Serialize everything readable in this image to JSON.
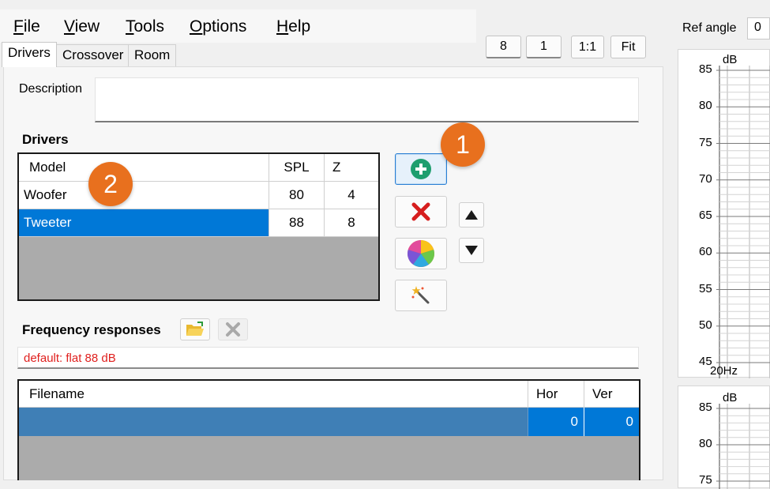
{
  "menu": {
    "items": [
      {
        "pre": "",
        "key": "F",
        "post": "ile"
      },
      {
        "pre": "",
        "key": "V",
        "post": "iew"
      },
      {
        "pre": "",
        "key": "T",
        "post": "ools"
      },
      {
        "pre": "",
        "key": "O",
        "post": "ptions"
      },
      {
        "pre": "",
        "key": "H",
        "post": "elp"
      }
    ]
  },
  "tabs": [
    "Drivers",
    "Crossover",
    "Room"
  ],
  "toolbar": {
    "b8": "8",
    "b1": "1",
    "b11": "1:1",
    "fit": "Fit"
  },
  "description": {
    "label": "Description",
    "value": ""
  },
  "drivers": {
    "title": "Drivers",
    "columns": [
      "Model",
      "SPL",
      "Z"
    ],
    "rows": [
      {
        "model": "Woofer",
        "spl": "80",
        "z": "4"
      },
      {
        "model": "Tweeter",
        "spl": "88",
        "z": "8"
      }
    ]
  },
  "badges": {
    "one": "1",
    "two": "2"
  },
  "freq": {
    "title": "Frequency responses",
    "default_text": "default: flat 88 dB",
    "columns": [
      "Filename",
      "Hor",
      "Ver"
    ],
    "rows": [
      {
        "filename": "",
        "hor": "0",
        "ver": "0"
      }
    ]
  },
  "right": {
    "ref_label": "Ref angle",
    "ref_value": "0",
    "chart1": {
      "unit": "dB",
      "ticks": [
        "85",
        "80",
        "75",
        "70",
        "65",
        "60",
        "55",
        "50",
        "45"
      ],
      "xlabel": "20Hz"
    },
    "chart2": {
      "unit": "dB",
      "ticks": [
        "85",
        "80",
        "75"
      ]
    }
  },
  "colors": {
    "selection": "#0078d7",
    "badge": "#e8701e",
    "default_text": "#e0201e",
    "file_row": "#3f7fb6"
  }
}
